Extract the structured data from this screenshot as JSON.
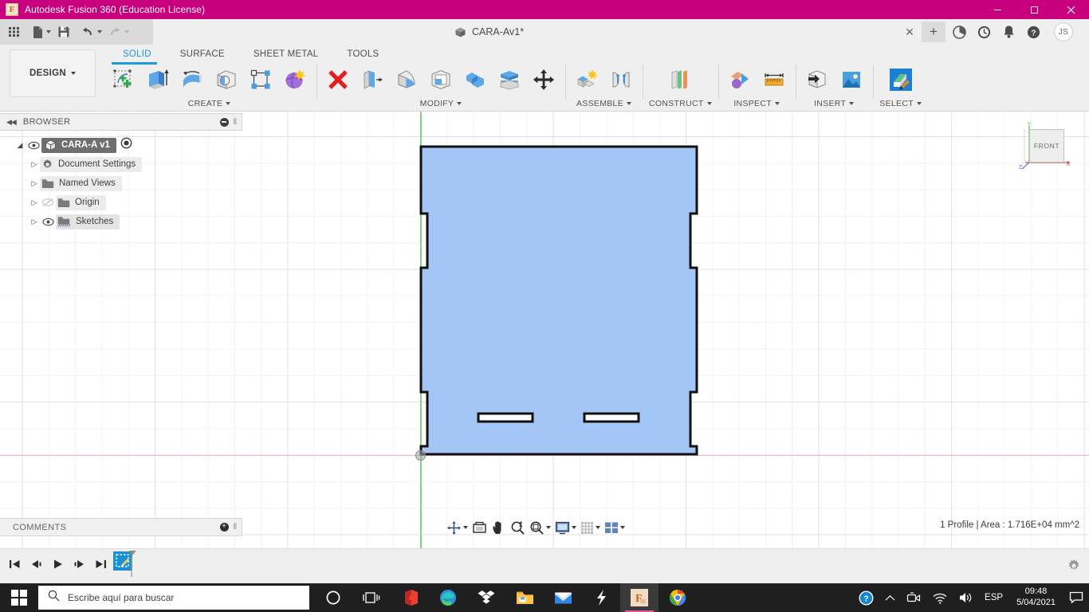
{
  "titlebar": {
    "app_icon": "fusion-logo-icon",
    "title": "Autodesk Fusion 360 (Education License)",
    "minimize": "─",
    "maximize": "☐",
    "close": "✕",
    "bg_color": "#c8007d"
  },
  "quick_access": {
    "grid_label": "apps-grid-icon",
    "new_label": "new-file-icon",
    "save_label": "save-icon",
    "undo_label": "undo-icon",
    "redo_label": "redo-icon"
  },
  "doctab": {
    "label": "CARA-Av1*",
    "icon": "cube-icon",
    "close": "✕",
    "new_tab": "+"
  },
  "tab_icons": {
    "extensions": "extensions-icon",
    "history": "job-status-icon",
    "notifications": "bell-icon",
    "help": "help-icon",
    "avatar_initials": "JS"
  },
  "workspace": {
    "label": "DESIGN"
  },
  "ribbon_tabs": [
    {
      "label": "SOLID",
      "active": true
    },
    {
      "label": "SURFACE",
      "active": false
    },
    {
      "label": "SHEET METAL",
      "active": false
    },
    {
      "label": "TOOLS",
      "active": false
    }
  ],
  "panels": [
    {
      "title": "CREATE",
      "icons": [
        "create-sketch-icon",
        "extrude-icon",
        "revolve-icon",
        "hole-icon",
        "rectangular-pattern-icon",
        "create-form-icon"
      ]
    },
    {
      "title": "MODIFY",
      "icons": [
        "finish-sketch-icon",
        "press-pull-icon",
        "fillet-icon",
        "shell-icon",
        "combine-icon",
        "offset-face-icon",
        "move-copy-icon"
      ]
    },
    {
      "title": "ASSEMBLE",
      "icons": [
        "new-component-icon",
        "joint-icon"
      ]
    },
    {
      "title": "CONSTRUCT",
      "icons": [
        "offset-plane-icon"
      ]
    },
    {
      "title": "INSPECT",
      "icons": [
        "section-analysis-icon",
        "measure-icon"
      ]
    },
    {
      "title": "INSERT",
      "icons": [
        "derive-icon",
        "decal-icon"
      ]
    },
    {
      "title": "SELECT",
      "icons": [
        "select-paint-icon"
      ]
    }
  ],
  "browser": {
    "title": "BROWSER",
    "collapse_icon": "collapse-left-icon",
    "settings_icon": "panel-menu-icon",
    "grip_icon": "resize-grip-icon",
    "items": [
      {
        "label": "CARA-A v1",
        "icon": "component-cube-icon",
        "arrow": "◢",
        "eye": "eye-visible-icon",
        "selected": true,
        "has_radio": true
      },
      {
        "label": "Document Settings",
        "icon": "gear-icon",
        "arrow": "▷",
        "eye": "",
        "selected": false,
        "has_radio": false
      },
      {
        "label": "Named Views",
        "icon": "folder-icon",
        "arrow": "▷",
        "eye": "",
        "selected": false,
        "has_radio": false
      },
      {
        "label": "Origin",
        "icon": "folder-icon",
        "arrow": "▷",
        "eye": "eye-hidden-icon",
        "selected": false,
        "has_radio": false
      },
      {
        "label": "Sketches",
        "icon": "sketches-folder-icon",
        "arrow": "▷",
        "eye": "eye-visible-icon",
        "selected": false,
        "has_radio": false
      }
    ]
  },
  "viewcube": {
    "face_label": "FRONT",
    "axis_x": "X",
    "axis_y": "Y",
    "axis_z": "Z",
    "color_x": "#e05050",
    "color_y": "#55b855",
    "color_z": "#5566dd"
  },
  "navbar": {
    "items": [
      {
        "name": "orbit-icon",
        "caret": true
      },
      {
        "name": "look-at-icon",
        "caret": false
      },
      {
        "name": "pan-icon",
        "caret": false
      },
      {
        "name": "zoom-icon",
        "caret": false
      },
      {
        "name": "fit-icon",
        "caret": true
      },
      {
        "name": "display-settings-icon",
        "caret": true
      },
      {
        "name": "grid-snaps-icon",
        "caret": true
      },
      {
        "name": "viewports-icon",
        "caret": true
      }
    ]
  },
  "comments": {
    "title": "COMMENTS",
    "add_icon": "+",
    "grip_icon": "resize-grip-icon"
  },
  "status": {
    "area_info": "1 Profile | Area : 1.716E+04 mm^2"
  },
  "timeline": {
    "controls": [
      "go-to-beginning-icon",
      "step-back-icon",
      "play-icon",
      "step-forward-icon",
      "go-to-end-icon"
    ],
    "feature_icon": "sketch-feature-icon",
    "settings_icon": "timeline-settings-icon"
  },
  "canvas": {
    "sketch_name": "sketch-profile",
    "profile_fill": "#a3c6f7",
    "profile_stroke": "#111111",
    "x_axis_color": "#f3b3b3",
    "y_axis_color": "#7fd47f",
    "origin_label": "origin-point"
  },
  "taskbar": {
    "start_label": "start-button",
    "search_placeholder": "Escribe aquí para buscar",
    "search_icon": "search-icon",
    "items": [
      {
        "name": "cortana-icon"
      },
      {
        "name": "task-view-icon"
      },
      {
        "name": "office-icon"
      },
      {
        "name": "edge-icon"
      },
      {
        "name": "dropbox-icon"
      },
      {
        "name": "file-explorer-icon"
      },
      {
        "name": "mail-icon"
      },
      {
        "name": "lightshot-icon"
      },
      {
        "name": "fusion360-icon"
      },
      {
        "name": "chrome-icon"
      }
    ],
    "tray": {
      "help": "help-circle-icon",
      "chevron": "⌃",
      "camera": "camera-icon",
      "wifi": "wifi-icon",
      "volume": "volume-icon",
      "language": "ESP",
      "time": "09:48",
      "date": "5/04/2021",
      "action_center": "action-center-icon"
    }
  }
}
